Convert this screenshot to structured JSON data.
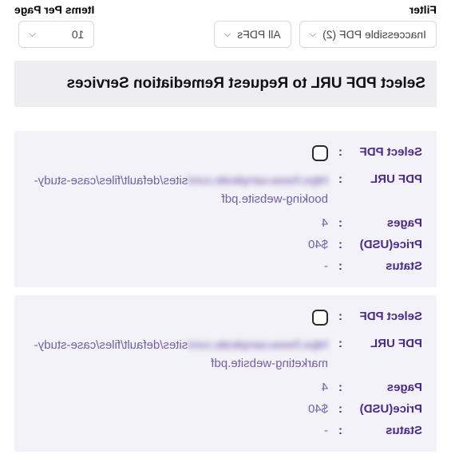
{
  "top": {
    "filter_label": "Filter",
    "filter1": "Inaccessible PDF (2)",
    "filter2": "All PDFs",
    "items_label": "Items Per Page",
    "items_value": "10"
  },
  "banner": "Select PDF URL to Request Remediation Services",
  "fields": {
    "select_pdf": "Select PDF",
    "pdf_url": "PDF URL",
    "pages": "Pages",
    "price": "Price(USD)",
    "status": "Status"
  },
  "items": [
    {
      "url_prefix": "https://www.samplesite.com/",
      "url_visible": "sites/default/files/case-study-booking-website.pdf",
      "pages": "4",
      "price": "$40",
      "status": "-"
    },
    {
      "url_prefix": "https://www.samplesite.com/",
      "url_visible": "sites/default/files/case-study-marketing-website.pdf",
      "pages": "4",
      "price": "$40",
      "status": "-"
    }
  ]
}
